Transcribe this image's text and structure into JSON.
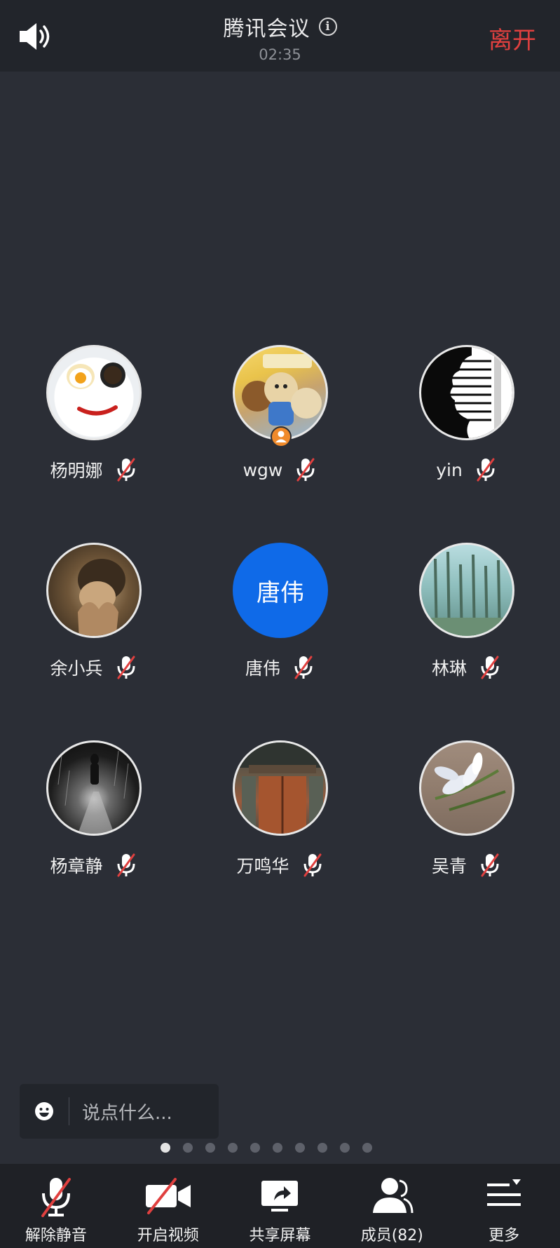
{
  "header": {
    "title": "腾讯会议",
    "timer": "02:35",
    "leave_label": "离开",
    "icons": {
      "speaker": "speaker-icon",
      "info": "info-icon"
    }
  },
  "participants": [
    {
      "name": "杨明娜",
      "avatar": "breakfast-plate-photo",
      "muted": true
    },
    {
      "name": "wgw",
      "avatar": "teddy-bears-photo",
      "muted": true,
      "host": true
    },
    {
      "name": "yin",
      "avatar": "black-white-silhouette",
      "muted": true
    },
    {
      "name": "余小兵",
      "avatar": "child-praying-photo",
      "muted": true
    },
    {
      "name": "唐伟",
      "avatar_text": "唐伟",
      "avatar_color": "#0f6ae8",
      "muted": true
    },
    {
      "name": "林琳",
      "avatar": "trees-photo",
      "muted": true
    },
    {
      "name": "杨章静",
      "avatar": "rain-figure-photo",
      "muted": true
    },
    {
      "name": "万鸣华",
      "avatar": "old-door-photo",
      "muted": true
    },
    {
      "name": "吴青",
      "avatar": "white-flower-photo",
      "muted": true
    }
  ],
  "chat": {
    "placeholder": "说点什么..."
  },
  "pager": {
    "total": 10,
    "current": 1
  },
  "toolbar": {
    "unmute_label": "解除静音",
    "video_label": "开启视频",
    "share_label": "共享屏幕",
    "members_label": "成员(82)",
    "more_label": "更多"
  },
  "colors": {
    "background": "#2b2e36",
    "header": "#22252b",
    "leave": "#e0403f",
    "muted_red": "#e0403f",
    "avatar_blue": "#0f6ae8",
    "toolbar": "#1f2126"
  }
}
